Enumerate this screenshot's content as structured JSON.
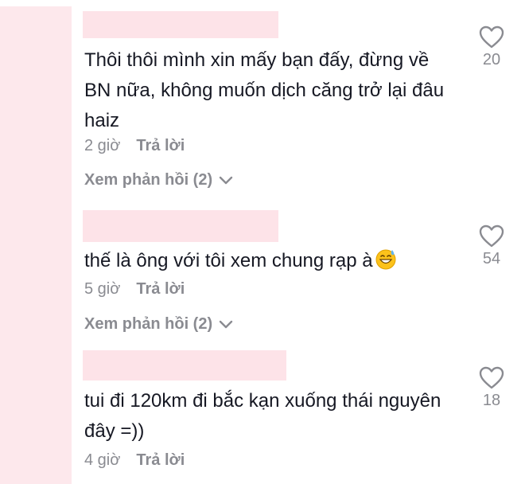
{
  "comments": [
    {
      "text": "Thôi thôi mình xin mấy bạn đấy, đừng về BN nữa, không muốn dịch căng trở lại đâu haiz",
      "time": "2 giờ",
      "reply_label": "Trả lời",
      "view_replies": "Xem phản hồi (2)",
      "likes": "20"
    },
    {
      "text": "thế là ông với tôi xem chung rạp à",
      "emoji": "grinning-sweat-emoji",
      "time": "5 giờ",
      "reply_label": "Trả lời",
      "view_replies": "Xem phản hồi (2)",
      "likes": "54"
    },
    {
      "text": "tui đi 120km đi bắc kạn xuống thái nguyên đây =))",
      "time": "4 giờ",
      "reply_label": "Trả lời",
      "likes": "18"
    }
  ],
  "icons": {
    "like": "heart-outline-icon",
    "expand": "chevron-down-icon"
  },
  "colors": {
    "text": "#161823",
    "muted": "#8a8b91",
    "redaction": "#fde3e8"
  }
}
